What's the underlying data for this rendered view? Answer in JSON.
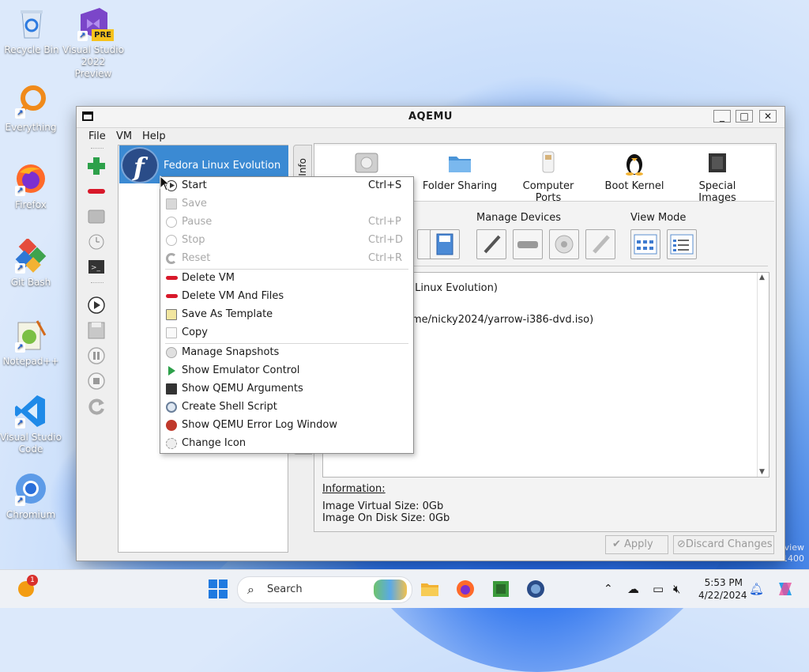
{
  "desktop": {
    "icons": [
      {
        "label": "Recycle Bin"
      },
      {
        "label": "Visual Studio 2022 Preview"
      },
      {
        "label": "Everything"
      },
      {
        "label": "Firefox"
      },
      {
        "label": "Git Bash"
      },
      {
        "label": "Notepad++"
      },
      {
        "label": "Visual Studio Code"
      },
      {
        "label": "Chromium"
      }
    ],
    "watermark_line1": "view",
    "watermark_line2": "1400",
    "pre_badge": "PRE"
  },
  "window": {
    "title": "AQEMU",
    "menu": {
      "file": "File",
      "vm": "VM",
      "help": "Help"
    },
    "vm_list": [
      {
        "name": "Fedora Linux Evolution",
        "logo_letter": "f"
      }
    ],
    "side_tab": "Info",
    "tabs": [
      {
        "label": "Folder Sharing",
        "icon": "folder-icon"
      },
      {
        "label": "Computer Ports",
        "icon": "usb-icon"
      },
      {
        "label": "Boot Kernel",
        "icon": "tux-icon"
      },
      {
        "label": "Special Images",
        "icon": "chip-icon"
      }
    ],
    "groups": {
      "manage_devices": "Manage Devices",
      "view_mode": "View Mode"
    },
    "details_text": {
      "line1": "a Linux Evolution)",
      "line2": "ome/nicky2024/yarrow-i386-dvd.iso)"
    },
    "information": {
      "heading": "Information:",
      "virtual_size": "Image Virtual Size: 0Gb",
      "disk_size": "Image On Disk Size: 0Gb"
    },
    "buttons": {
      "apply": "Apply",
      "discard": "Discard Changes"
    }
  },
  "context_menu": {
    "items": [
      {
        "label": "Start",
        "shortcut": "Ctrl+S",
        "enabled": true,
        "icon": "play-icon"
      },
      {
        "label": "Save",
        "shortcut": "",
        "enabled": false,
        "icon": "save-icon"
      },
      {
        "label": "Pause",
        "shortcut": "Ctrl+P",
        "enabled": false,
        "icon": "pause-icon"
      },
      {
        "label": "Stop",
        "shortcut": "Ctrl+D",
        "enabled": false,
        "icon": "stop-icon"
      },
      {
        "label": "Reset",
        "shortcut": "Ctrl+R",
        "enabled": false,
        "icon": "reset-icon"
      },
      {
        "label": "Delete VM",
        "shortcut": "",
        "enabled": true,
        "icon": "delete-icon"
      },
      {
        "label": "Delete VM And Files",
        "shortcut": "",
        "enabled": true,
        "icon": "delete-icon"
      },
      {
        "label": "Save As Template",
        "shortcut": "",
        "enabled": true,
        "icon": "template-icon"
      },
      {
        "label": "Copy",
        "shortcut": "",
        "enabled": true,
        "icon": "copy-icon"
      },
      {
        "label": "Manage Snapshots",
        "shortcut": "",
        "enabled": true,
        "icon": "snapshot-icon"
      },
      {
        "label": "Show Emulator Control",
        "shortcut": "",
        "enabled": true,
        "icon": "emulator-icon"
      },
      {
        "label": "Show QEMU Arguments",
        "shortcut": "",
        "enabled": true,
        "icon": "terminal-icon"
      },
      {
        "label": "Create Shell Script",
        "shortcut": "",
        "enabled": true,
        "icon": "script-icon"
      },
      {
        "label": "Show QEMU Error Log Window",
        "shortcut": "",
        "enabled": true,
        "icon": "bug-icon"
      },
      {
        "label": "Change Icon",
        "shortcut": "",
        "enabled": true,
        "icon": "change-icon-icon"
      }
    ]
  },
  "taskbar": {
    "search_placeholder": "Search",
    "notification_count": "1",
    "time": "5:53 PM",
    "date": "4/22/2024"
  },
  "colors": {
    "selection": "#3b8ad3",
    "accent": "#1b5fd6"
  }
}
